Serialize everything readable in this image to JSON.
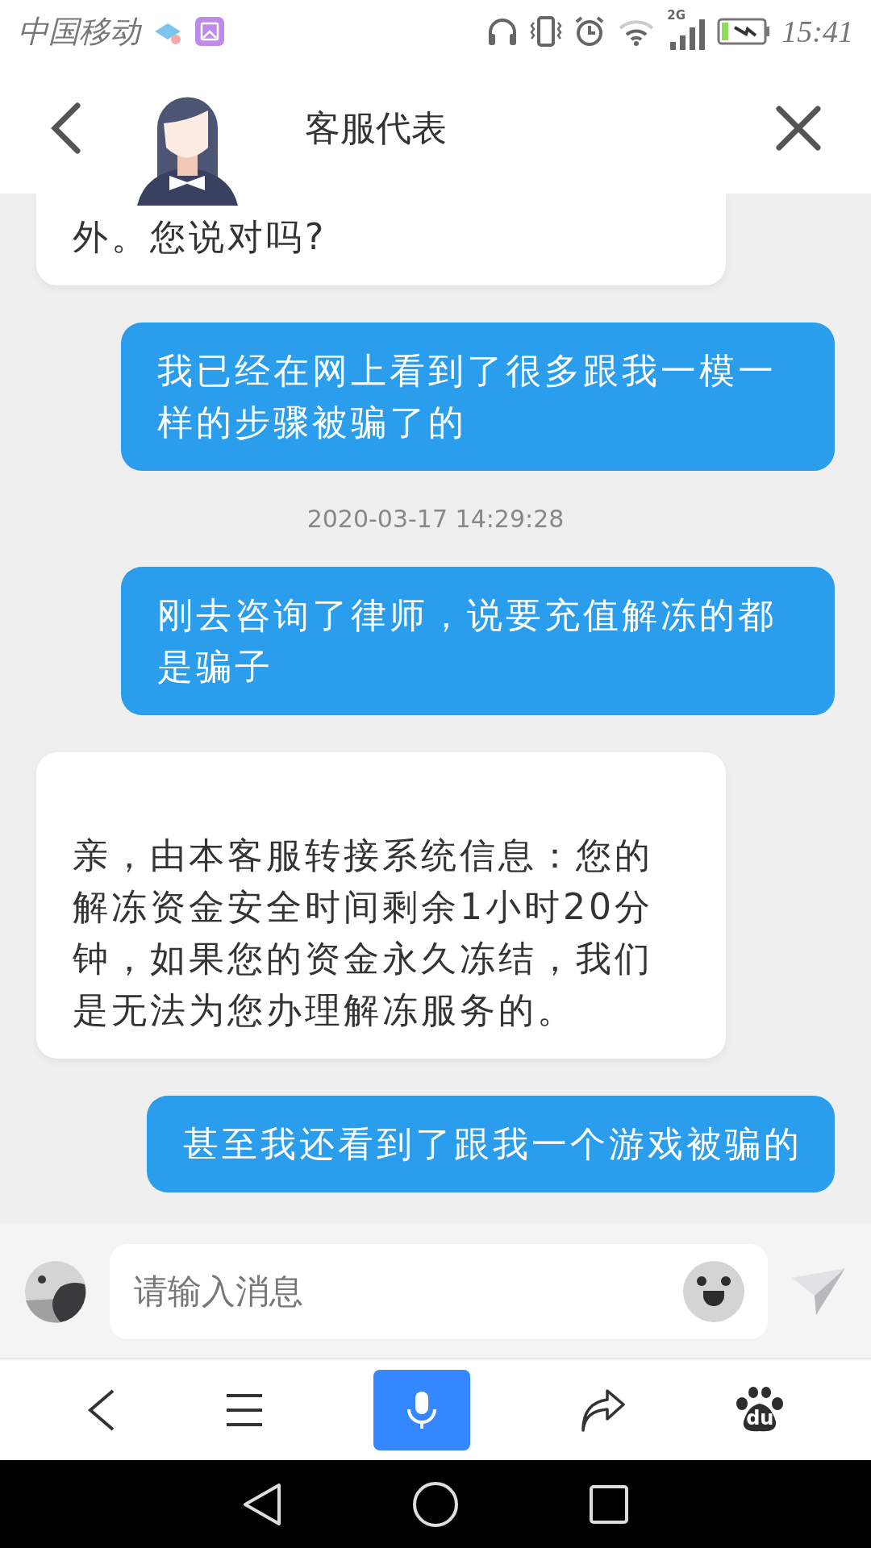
{
  "status_bar": {
    "carrier": "中国移动",
    "network": "2G",
    "time": "15:41"
  },
  "header": {
    "title": "客服代表"
  },
  "messages": [
    {
      "kind": "agent",
      "text": "外。您说对吗?"
    },
    {
      "kind": "user",
      "text": "我已经在网上看到了很多跟我一模一样的步骤被骗了的"
    },
    {
      "kind": "time",
      "text": "2020-03-17 14:29:28"
    },
    {
      "kind": "user",
      "text": "刚去咨询了律师，说要充值解冻的都是骗子"
    },
    {
      "kind": "agent",
      "text": "亲，由本客服转接系统信息：您的解冻资金安全时间剩余1小时20分钟，如果您的资金永久冻结，我们是无法为您办理解冻服务的。"
    },
    {
      "kind": "user",
      "text": "甚至我还看到了跟我一个游戏被骗的"
    }
  ],
  "input": {
    "placeholder": "请输入消息"
  },
  "browser_bar": {
    "logo_text": "du"
  }
}
